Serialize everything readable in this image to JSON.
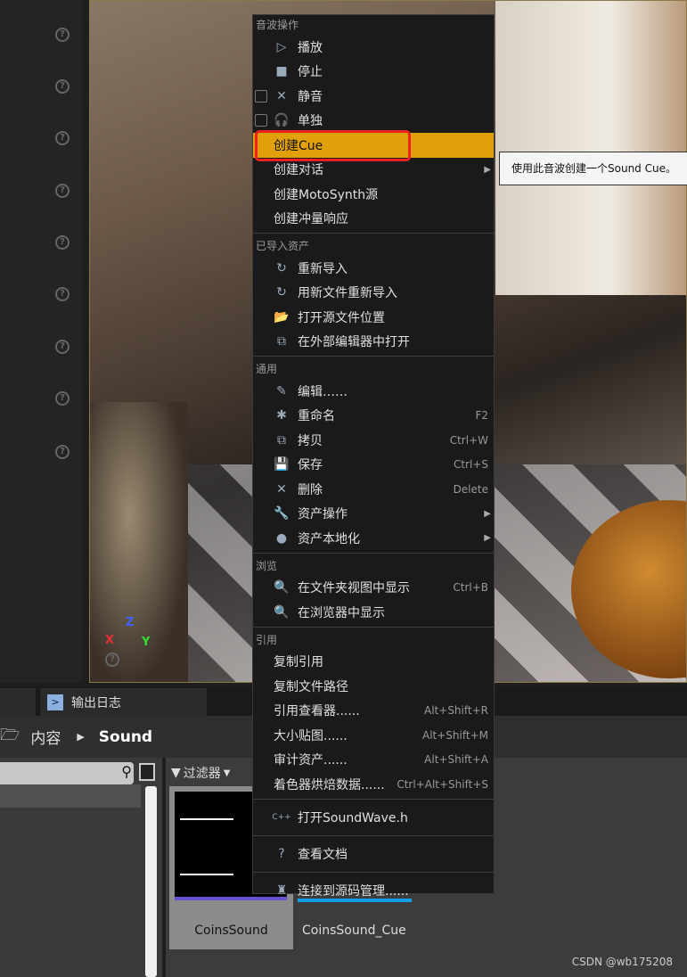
{
  "viewport": {
    "axis_x": "X",
    "axis_y": "Y",
    "axis_z": "Z"
  },
  "tabs": [
    {
      "label": "输出日志",
      "icon": "terminal-icon"
    }
  ],
  "breadcrumb": {
    "root": "内容",
    "current": "Sound"
  },
  "filter": {
    "label": "过滤器"
  },
  "assets": [
    {
      "name": "CoinsSound",
      "color": "#6a50d0"
    },
    {
      "name": "CoinsSound_Cue",
      "color": "#10a0e8"
    }
  ],
  "menu": {
    "sections": [
      {
        "header": "音波操作",
        "items": [
          {
            "label": "播放",
            "icon": "play-icon"
          },
          {
            "label": "停止",
            "icon": "stop-icon"
          },
          {
            "label": "静音",
            "icon": "mute-icon",
            "checkbox": true
          },
          {
            "label": "单独",
            "icon": "headphones-icon",
            "checkbox": true
          },
          {
            "label": "创建Cue",
            "highlight": true
          },
          {
            "label": "创建对话",
            "submenu": true
          },
          {
            "label": "创建MotoSynth源"
          },
          {
            "label": "创建冲量响应"
          }
        ]
      },
      {
        "header": "已导入资产",
        "items": [
          {
            "label": "重新导入",
            "icon": "reimport-icon"
          },
          {
            "label": "用新文件重新导入",
            "icon": "reimport-icon"
          },
          {
            "label": "打开源文件位置",
            "icon": "folder-open-icon"
          },
          {
            "label": "在外部编辑器中打开",
            "icon": "external-editor-icon"
          }
        ]
      },
      {
        "header": "通用",
        "items": [
          {
            "label": "编辑……",
            "icon": "edit-icon"
          },
          {
            "label": "重命名",
            "icon": "rename-icon",
            "shortcut": "F2"
          },
          {
            "label": "拷贝",
            "icon": "duplicate-icon",
            "shortcut": "Ctrl+W"
          },
          {
            "label": "保存",
            "icon": "save-icon",
            "shortcut": "Ctrl+S"
          },
          {
            "label": "删除",
            "icon": "delete-icon",
            "shortcut": "Delete"
          },
          {
            "label": "资产操作",
            "icon": "wrench-icon",
            "submenu": true
          },
          {
            "label": "资产本地化",
            "icon": "globe-icon",
            "submenu": true
          }
        ]
      },
      {
        "header": "浏览",
        "items": [
          {
            "label": "在文件夹视图中显示",
            "icon": "magnifier-icon",
            "shortcut": "Ctrl+B"
          },
          {
            "label": "在浏览器中显示",
            "icon": "magnifier-icon"
          }
        ]
      },
      {
        "header": "引用",
        "items": [
          {
            "label": "复制引用"
          },
          {
            "label": "复制文件路径"
          },
          {
            "label": "引用查看器......",
            "shortcut": "Alt+Shift+R"
          },
          {
            "label": "大小贴图......",
            "shortcut": "Alt+Shift+M"
          },
          {
            "label": "审计资产......",
            "shortcut": "Alt+Shift+A"
          },
          {
            "label": "着色器烘焙数据......",
            "shortcut": "Ctrl+Alt+Shift+S"
          }
        ]
      },
      {
        "items": [
          {
            "label": "打开SoundWave.h",
            "icon": "cpp-icon",
            "tall": true
          }
        ]
      },
      {
        "items": [
          {
            "label": "查看文档",
            "icon": "help-icon",
            "tall": true
          }
        ]
      },
      {
        "items": [
          {
            "label": "连接到源码管理......",
            "icon": "source-control-icon",
            "tall": true
          }
        ]
      }
    ]
  },
  "tooltip": "使用此音波创建一个Sound Cue。",
  "watermark": "CSDN @wb175208"
}
